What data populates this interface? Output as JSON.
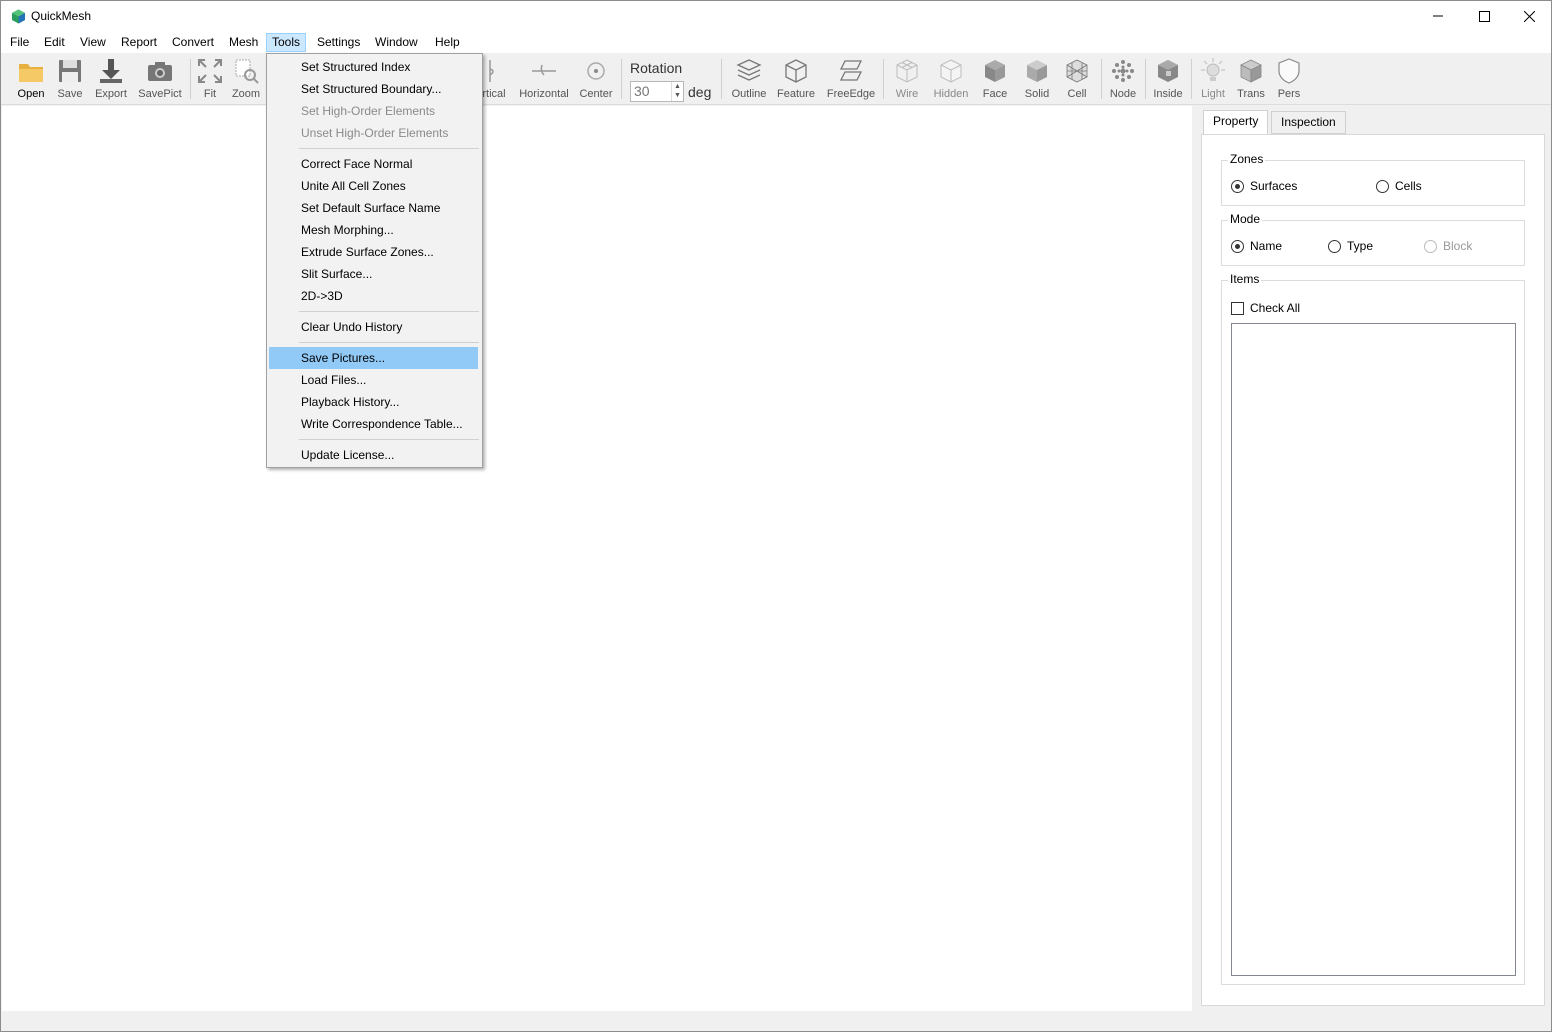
{
  "app": {
    "title": "QuickMesh"
  },
  "menubar": [
    "File",
    "Edit",
    "View",
    "Report",
    "Convert",
    "Mesh",
    "Tools",
    "Settings",
    "Window",
    "Help"
  ],
  "toolbar": {
    "open": "Open",
    "save": "Save",
    "export": "Export",
    "savepict": "SavePict",
    "fit": "Fit",
    "zoom": "Zoom",
    "vertical": "rtical",
    "horizontal": "Horizontal",
    "center": "Center",
    "rotation_label": "Rotation",
    "rotation_value": "30",
    "rotation_unit": "deg",
    "outline": "Outline",
    "feature": "Feature",
    "freeedge": "FreeEdge",
    "wire": "Wire",
    "hidden": "Hidden",
    "face": "Face",
    "solid": "Solid",
    "cell": "Cell",
    "node": "Node",
    "inside": "Inside",
    "light": "Light",
    "trans": "Trans",
    "pers": "Pers"
  },
  "tools_menu": {
    "items": [
      "Set Structured Index",
      "Set Structured Boundary...",
      "Set High-Order Elements",
      "Unset High-Order Elements",
      "Correct Face Normal",
      "Unite All Cell Zones",
      "Set Default Surface Name",
      "Mesh Morphing...",
      "Extrude Surface Zones...",
      "Slit Surface...",
      "2D->3D",
      "Clear Undo History",
      "Save Pictures...",
      "Load Files...",
      "Playback History...",
      "Write Correspondence Table...",
      "Update License..."
    ]
  },
  "panel": {
    "tabs": [
      "Property",
      "Inspection"
    ],
    "zones": {
      "title": "Zones",
      "surfaces": "Surfaces",
      "cells": "Cells"
    },
    "mode": {
      "title": "Mode",
      "name": "Name",
      "type": "Type",
      "block": "Block"
    },
    "items": {
      "title": "Items",
      "check_all": "Check All"
    }
  }
}
